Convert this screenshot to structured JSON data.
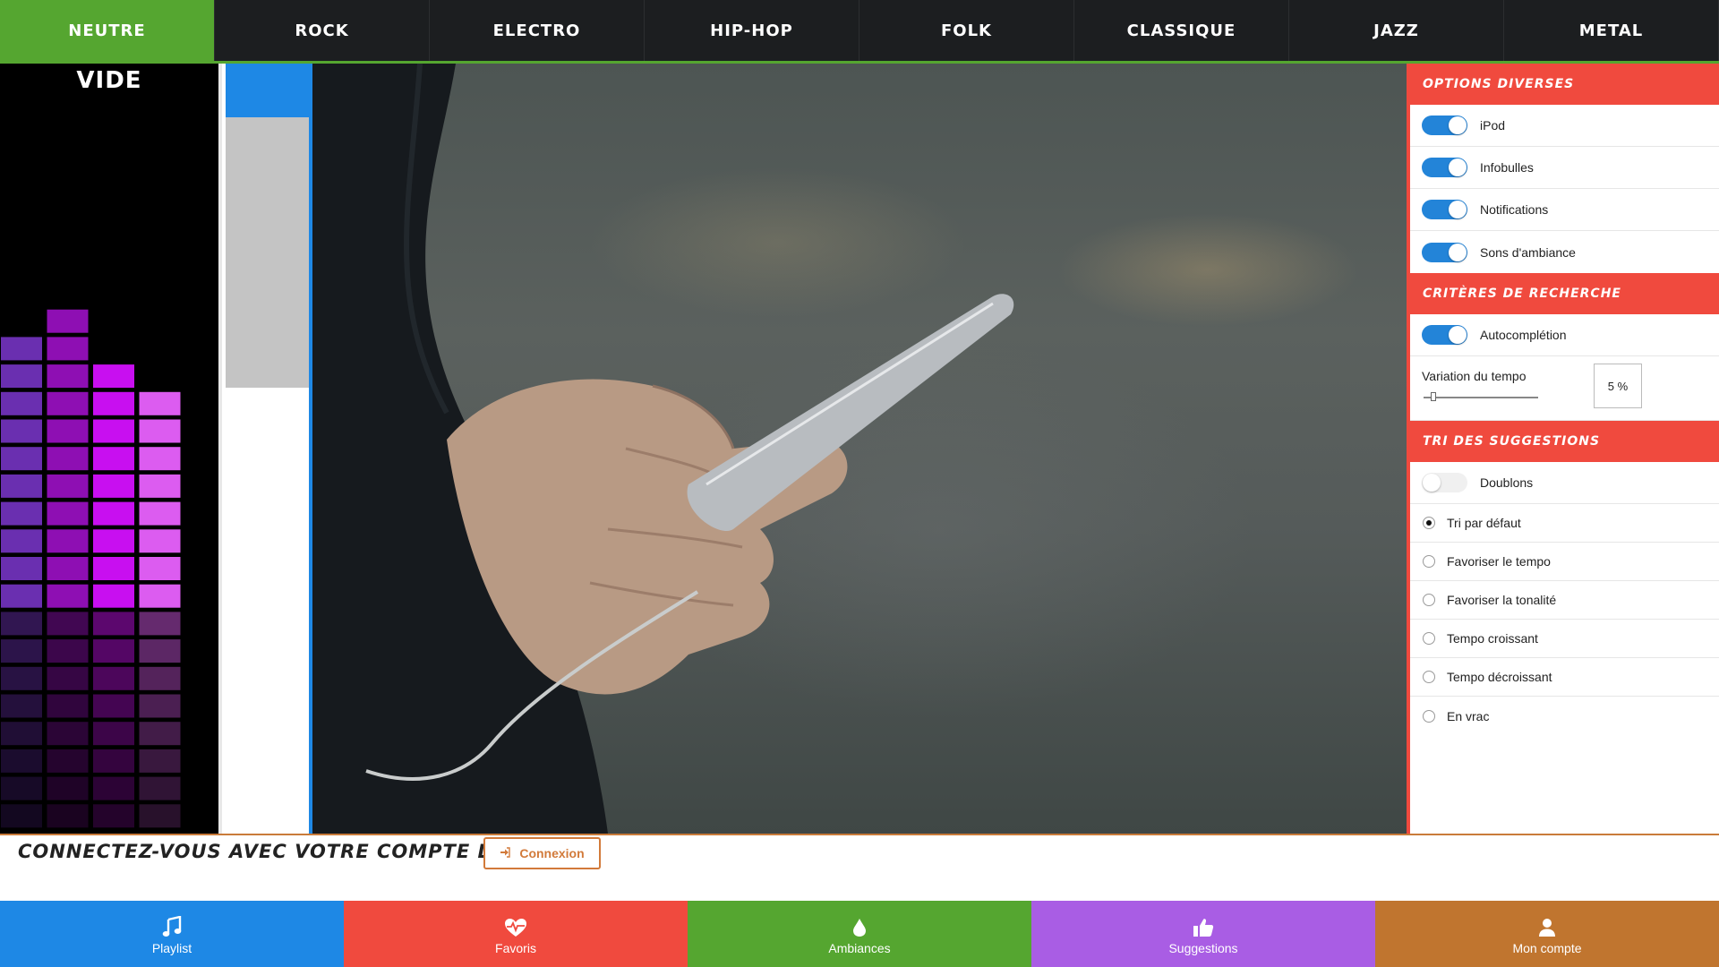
{
  "genres": [
    {
      "label": "NEUTRE",
      "active": true
    },
    {
      "label": "ROCK"
    },
    {
      "label": "ELECTRO"
    },
    {
      "label": "HIP-HOP"
    },
    {
      "label": "FOLK"
    },
    {
      "label": "CLASSIQUE"
    },
    {
      "label": "JAZZ"
    },
    {
      "label": "METAL"
    }
  ],
  "visualizer": {
    "title": "VIDE",
    "levels": [
      10,
      11,
      9,
      8
    ],
    "total_cells": 20,
    "colors": [
      "#6a2fb0",
      "#8e0fb3",
      "#c80ff0",
      "#dc5cf0"
    ]
  },
  "options": {
    "section1_title": "Options diverses",
    "toggles": [
      {
        "label": "iPod",
        "on": true
      },
      {
        "label": "Infobulles",
        "on": true
      },
      {
        "label": "Notifications",
        "on": true
      },
      {
        "label": "Sons d'ambiance",
        "on": true
      }
    ],
    "section2_title": "Critères de recherche",
    "autocomplete_label": "Autocomplétion",
    "autocomplete_on": true,
    "tempo_label": "Variation du tempo",
    "tempo_value": "5 %",
    "section3_title": "Tri des suggestions",
    "doublons_label": "Doublons",
    "doublons_on": false,
    "sort_options": [
      {
        "label": "Tri par défaut",
        "selected": true
      },
      {
        "label": "Favoriser le tempo"
      },
      {
        "label": "Favoriser la tonalité"
      },
      {
        "label": "Tempo croissant"
      },
      {
        "label": "Tempo décroissant"
      },
      {
        "label": "En vrac"
      }
    ]
  },
  "login": {
    "message": "Connectez-vous avec votre compte Deezer !",
    "button_label": "Connexion",
    "button_icon": "sign-in-icon"
  },
  "bottom_nav": [
    {
      "label": "Playlist",
      "icon": "music-note-icon",
      "color": "#1e88e5"
    },
    {
      "label": "Favoris",
      "icon": "heartbeat-icon",
      "color": "#f04a3e"
    },
    {
      "label": "Ambiances",
      "icon": "drop-icon",
      "color": "#55a630"
    },
    {
      "label": "Suggestions",
      "icon": "thumbs-up-icon",
      "color": "#a95de4"
    },
    {
      "label": "Mon compte",
      "icon": "user-icon",
      "color": "#c0752f"
    }
  ],
  "colors": {
    "accent_green": "#55a630",
    "accent_red": "#f04a3e",
    "accent_blue": "#1e88e5",
    "login_orange": "#d27a3a"
  }
}
